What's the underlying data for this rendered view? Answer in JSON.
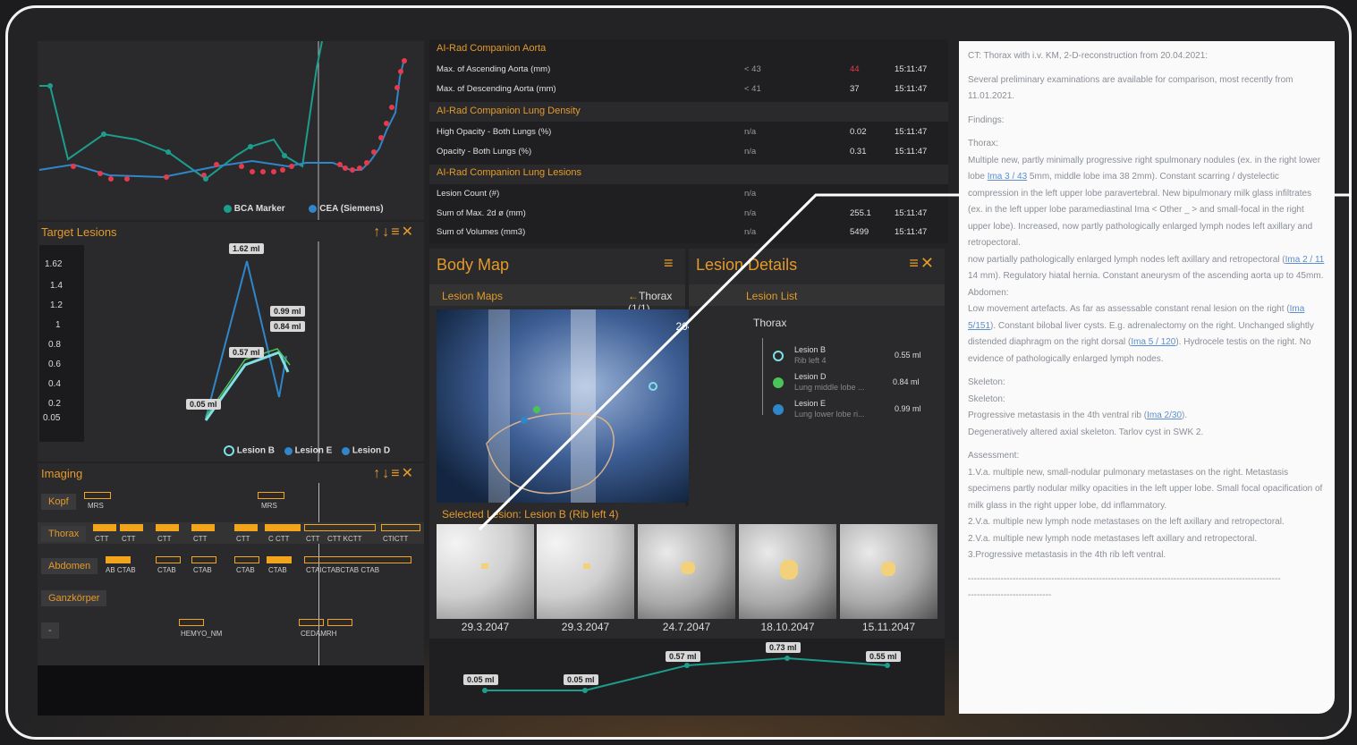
{
  "trend": {
    "legend": [
      {
        "label": "BCA Marker",
        "color": "#1b9e8c"
      },
      {
        "label": "CEA (Siemens)",
        "color": "#2f86c8"
      }
    ],
    "colors": {
      "bca": "#1b9e8c",
      "cea": "#e83a4a"
    }
  },
  "target_lesions": {
    "title": "Target Lesions",
    "icons": "↑↓≡✕",
    "y_ticks": [
      "1.62",
      "1.4",
      "1.2",
      "1",
      "0.8",
      "0.6",
      "0.4",
      "0.2",
      "0.05"
    ],
    "labels": [
      "1.62 ml",
      "0.99 ml",
      "0.84 ml",
      "0.57 ml",
      "0.05 ml"
    ],
    "legend": [
      {
        "label": "Lesion B",
        "color": "#7fe0e6"
      },
      {
        "label": "Lesion E",
        "color": "#2f86c8"
      },
      {
        "label": "Lesion D",
        "color": "#2f86c8"
      }
    ]
  },
  "imaging": {
    "title": "Imaging",
    "icons": "↑↓≡✕",
    "rows": [
      {
        "label": "Kopf",
        "items": [
          "MRS",
          "MRS"
        ]
      },
      {
        "label": "Thorax",
        "items": [
          "CTT",
          "CTT",
          "CTT",
          "CTT",
          "CTT",
          "C CTT",
          "CTT",
          "CTT KCTT",
          "CTICTT"
        ]
      },
      {
        "label": "Abdomen",
        "items": [
          "AB CTAB",
          "CTAB",
          "CTAB",
          "CTAB",
          "CTAB",
          "CTAICTABCTAB CTAB"
        ]
      },
      {
        "label": "Ganzkörper",
        "items": []
      },
      {
        "label": "-",
        "items": [
          "HEMYO_NM",
          "CEDAMRH"
        ]
      }
    ]
  },
  "ai_table": {
    "sections": [
      {
        "title": "AI-Rad Companion Aorta",
        "rows": [
          {
            "name": "Max. of Ascending Aorta (mm)",
            "ref": "< 43",
            "val": "44",
            "time": "15:11:47",
            "alert": true
          },
          {
            "name": "Max. of Descending Aorta (mm)",
            "ref": "< 41",
            "val": "37",
            "time": "15:11:47",
            "alert": false
          }
        ]
      },
      {
        "title": "AI-Rad Companion Lung Density",
        "rows": [
          {
            "name": "High Opacity - Both Lungs (%)",
            "ref": "n/a",
            "val": "0.02",
            "time": "15:11:47",
            "alert": false
          },
          {
            "name": "Opacity - Both Lungs (%)",
            "ref": "n/a",
            "val": "0.31",
            "time": "15:11:47",
            "alert": false
          }
        ]
      },
      {
        "title": "AI-Rad Companion Lung Lesions",
        "rows": [
          {
            "name": "Lesion Count (#)",
            "ref": "n/a",
            "val": "",
            "time": "",
            "alert": false
          },
          {
            "name": "Sum of Max. 2d ø (mm)",
            "ref": "n/a",
            "val": "255.1",
            "time": "15:11:47",
            "alert": false
          },
          {
            "name": "Sum of Volumes (mm3)",
            "ref": "n/a",
            "val": "5499",
            "time": "15:11:47",
            "alert": false
          }
        ]
      }
    ]
  },
  "body_map": {
    "title": "Body Map",
    "lesion_maps": "Lesion Maps",
    "nav": "Thorax (1/1)",
    "date": "2047-11-15",
    "selected": "Selected Lesion: Lesion B (Rib left 4)"
  },
  "lesion_details": {
    "title": "Lesion Details",
    "list_title": "Lesion List",
    "group": "Thorax",
    "items": [
      {
        "name": "Lesion B",
        "sub": "Rib left 4",
        "vol": "0.55 ml",
        "color": "#7fe0e6"
      },
      {
        "name": "Lesion D",
        "sub": "Lung middle lobe ...",
        "vol": "0.84 ml",
        "color": "#4cc35a"
      },
      {
        "name": "Lesion E",
        "sub": "Lung lower lobe ri...",
        "vol": "0.99 ml",
        "color": "#2f86c8"
      }
    ]
  },
  "thumbs": {
    "dates": [
      "29.3.2047",
      "29.3.2047",
      "24.7.2047",
      "18.10.2047",
      "15.11.2047"
    ]
  },
  "volume_trend": {
    "labels": [
      "0.05 ml",
      "0.05 ml",
      "0.57 ml",
      "0.73 ml",
      "0.55 ml"
    ]
  },
  "report": {
    "p1": "CT: Thorax with i.v. KM, 2-D-reconstruction from 20.04.2021:",
    "p2": "Several preliminary examinations are available for comparison, most recently from 11.01.2021.",
    "p3": "Findings:",
    "p4": "Thorax:",
    "p5a": "Multiple new, partly minimally progressive right spulmonary nodules (ex. in the right lower lobe ",
    "p5link": "Ima 3 / 43",
    "p5b": " 5mm, middle lobe ima 38 2mm). Constant scarring / dystelectic compression in the left upper lobe paravertebral. New bipulmonary milk glass infiltrates (ex. in the left upper lobe paramediastinal Ima < Other _ > and small-focal in the right upper lobe). Increased, now partly pathologically enlarged lymph nodes left axillary and retropectoral.",
    "p6a": "now partially pathologically enlarged lymph nodes left axillary and retropectoral (",
    "p6link": "Ima 2 / 11",
    "p6b": " 14 mm). Regulatory hiatal hernia. Constant aneurysm of the ascending aorta up to 45mm.",
    "p7": "Abdomen:",
    "p8a": "Low movement artefacts. As far as assessable constant renal lesion on the right (",
    "p8link": "Ima 5/151",
    "p8b": "). Constant bilobal liver cysts. E.g. adrenalectomy on the right. Unchanged slightly distended diaphragm on the right dorsal (",
    "p8link2": "Ima 5 / 120",
    "p8c": "). Hydrocele testis on the right. No evidence of pathologically enlarged lymph nodes.",
    "p9": "Skeleton:",
    "p10": "Skeleton:",
    "p11a": "Progressive metastasis in the 4th ventral rib (",
    "p11link": "Ima 2/30",
    "p11b": ").",
    "p12": "Degeneratively altered axial skeleton. Tarlov cyst in SWK 2.",
    "p13": "Assessment:",
    "p14": "1.V.a. multiple new, small-nodular pulmonary metastases on the right. Metastasis specimens partly nodular milky opacities in the left upper lobe. Small focal opacification of milk glass in the right upper lobe, dd inflammatory.",
    "p15": "2.V.a. multiple new lymph node metastases on the left axillary and retropectoral.",
    "p16": "2.V.a. multiple new lymph node metastases left axillary and retropectoral.",
    "p17": "3.Progressive metastasis in the 4th rib left ventral.",
    "dash1": "---------------------------------------------------------------------------------------------------------",
    "dash2": "----------------------------"
  }
}
